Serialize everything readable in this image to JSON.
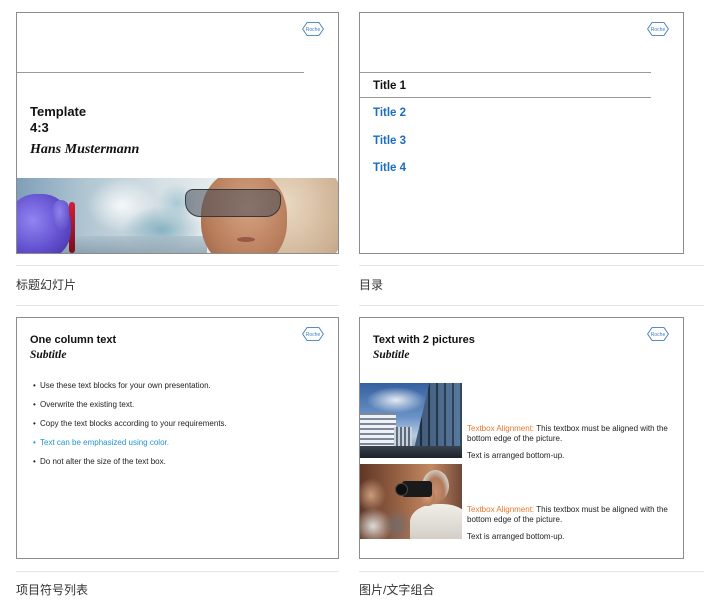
{
  "brand": {
    "logo_text": "Roche",
    "logo_color": "#3f7cc4"
  },
  "colors": {
    "text": "#111111",
    "toc_link": "#1a6dbf",
    "emphasis": "#2196d3",
    "alignment_label": "#e8792d",
    "caption": "#333333"
  },
  "templates": [
    {
      "caption": "标题幻灯片",
      "slide": {
        "title_lines": [
          "Template",
          "4:3"
        ],
        "author": "Hans Mustermann"
      }
    },
    {
      "caption": "目录",
      "slide": {
        "items": [
          "Title 1",
          "Title 2",
          "Title 3",
          "Title 4"
        ]
      }
    },
    {
      "caption": "项目符号列表",
      "slide": {
        "title": "One column text",
        "subtitle": "Subtitle",
        "bullets": [
          {
            "text": "Use these text blocks for your own presentation."
          },
          {
            "text": "Overwrite the existing text."
          },
          {
            "text": "Copy the text blocks according to your requirements."
          },
          {
            "text": "Text can be emphasized using color.",
            "emphasized": true
          },
          {
            "text": "Do not alter the size of the text box."
          }
        ]
      }
    },
    {
      "caption": "图片/文字组合",
      "slide": {
        "title": "Text with 2 pictures",
        "subtitle": "Subtitle",
        "blocks": [
          {
            "label": "Textbox Alignment:",
            "text": "This textbox must be aligned with the bottom edge of the picture.",
            "note": "Text is arranged bottom-up."
          },
          {
            "label": "Textbox Alignment:",
            "text": "This textbox must be aligned with the bottom edge of the picture.",
            "note": "Text is arranged bottom-up."
          }
        ]
      }
    }
  ]
}
